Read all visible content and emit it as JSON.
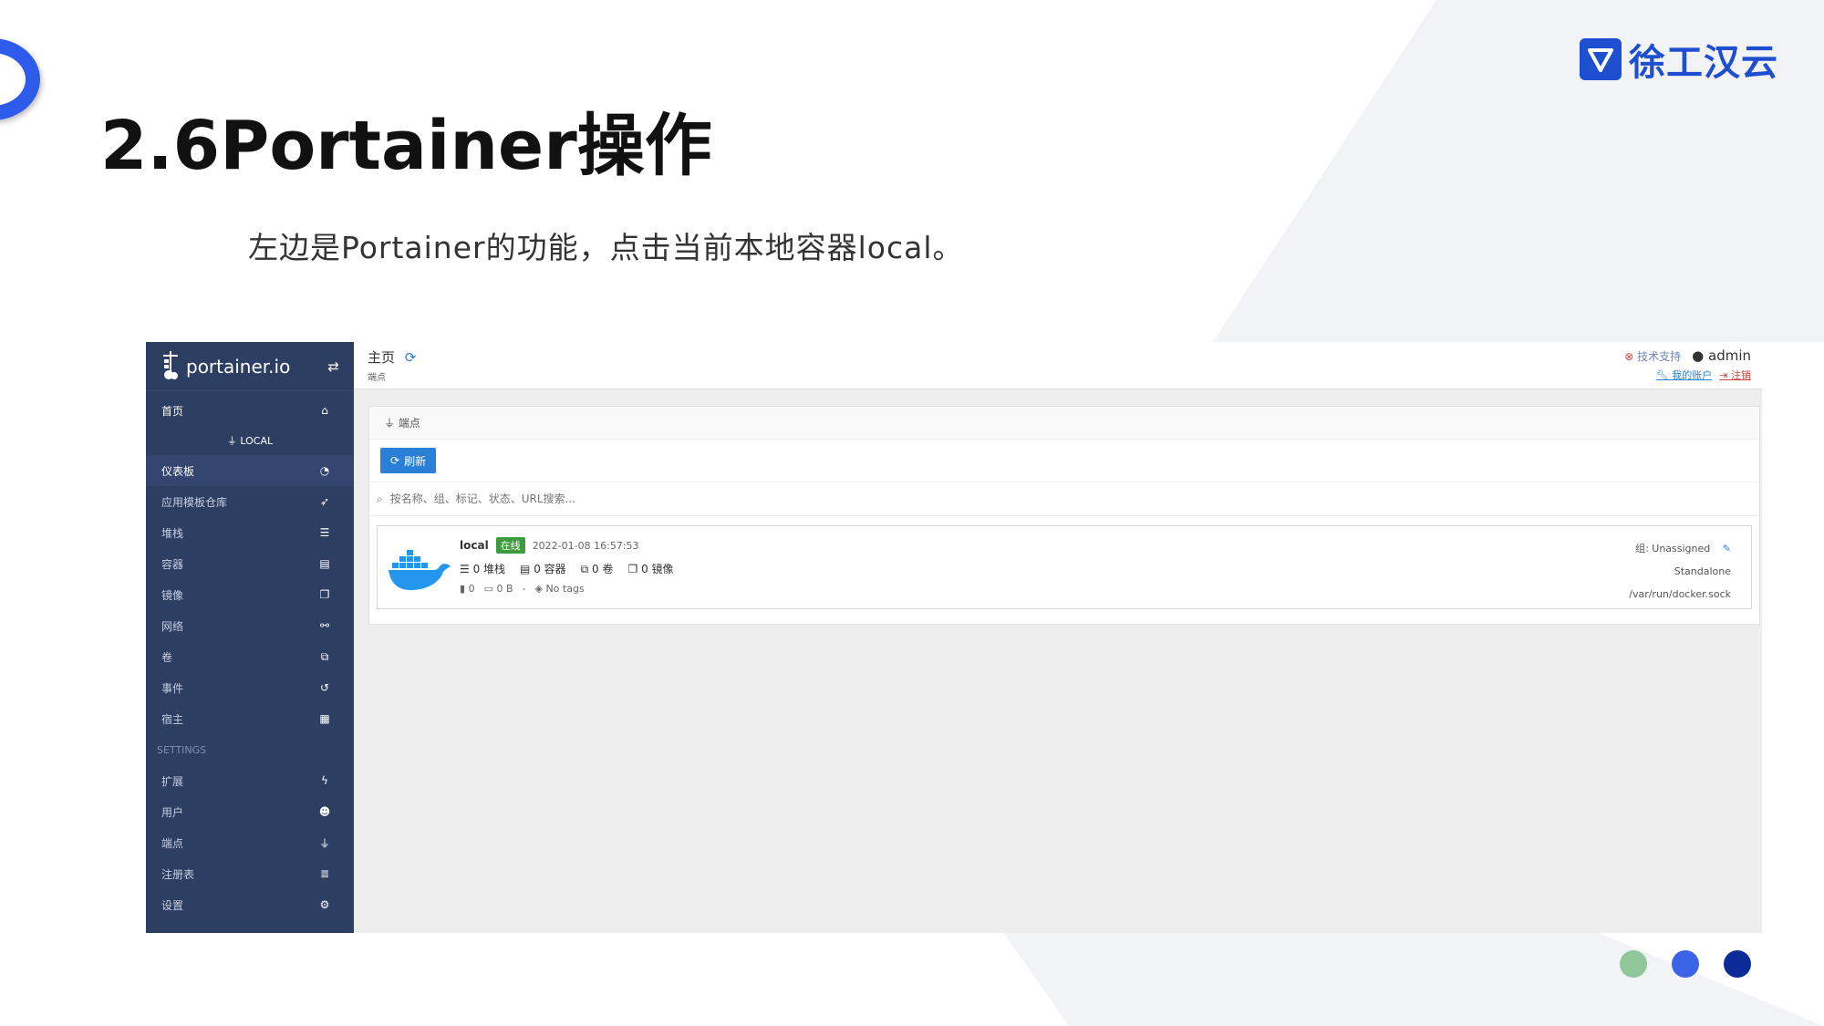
{
  "slide": {
    "brand_name": "徐工汉云",
    "title": "2.6Portainer操作",
    "subtitle": "左边是Portainer的功能，点击当前本地容器local。",
    "colors": {
      "accent": "#2f5bea",
      "brand": "#1e4fd0",
      "dot1": "#8fc79a",
      "dot2": "#3a63e6",
      "dot3": "#0b2c96"
    }
  },
  "portainer": {
    "logo_text": "portainer.io",
    "sidebar": {
      "home": {
        "label": "首页",
        "icon": "home-icon"
      },
      "local_label": "LOCAL",
      "items": [
        {
          "label": "仪表板",
          "icon": "dashboard-icon",
          "active": true
        },
        {
          "label": "应用模板仓库",
          "icon": "rocket-icon"
        },
        {
          "label": "堆栈",
          "icon": "list-icon"
        },
        {
          "label": "容器",
          "icon": "server-icon"
        },
        {
          "label": "镜像",
          "icon": "clone-icon"
        },
        {
          "label": "网络",
          "icon": "sitemap-icon"
        },
        {
          "label": "卷",
          "icon": "cubes-icon"
        },
        {
          "label": "事件",
          "icon": "history-icon"
        },
        {
          "label": "宿主",
          "icon": "grid-icon"
        }
      ],
      "settings_label": "SETTINGS",
      "settings_items": [
        {
          "label": "扩展",
          "icon": "bolt-icon"
        },
        {
          "label": "用户",
          "icon": "users-icon"
        },
        {
          "label": "端点",
          "icon": "plug-icon"
        },
        {
          "label": "注册表",
          "icon": "database-icon"
        },
        {
          "label": "设置",
          "icon": "cogs-icon"
        }
      ]
    },
    "topbar": {
      "title": "主页",
      "subtitle": "端点",
      "support_label": "技术支持",
      "user": "admin",
      "my_account": "我的账户",
      "logout": "注销"
    },
    "panel": {
      "header": "端点",
      "refresh_button": "刷新",
      "search_placeholder": "按名称、组、标记、状态、URL搜索..."
    },
    "endpoint": {
      "name": "local",
      "status": "在线",
      "date": "2022-01-08 16:57:53",
      "stacks": "0 堆栈",
      "containers": "0 容器",
      "volumes": "0 卷",
      "images": "0 镜像",
      "cpu": "0",
      "memory": "0 B",
      "separator": "-",
      "tags": "No tags",
      "group": "组: Unassigned",
      "type": "Standalone",
      "url": "/var/run/docker.sock"
    }
  }
}
